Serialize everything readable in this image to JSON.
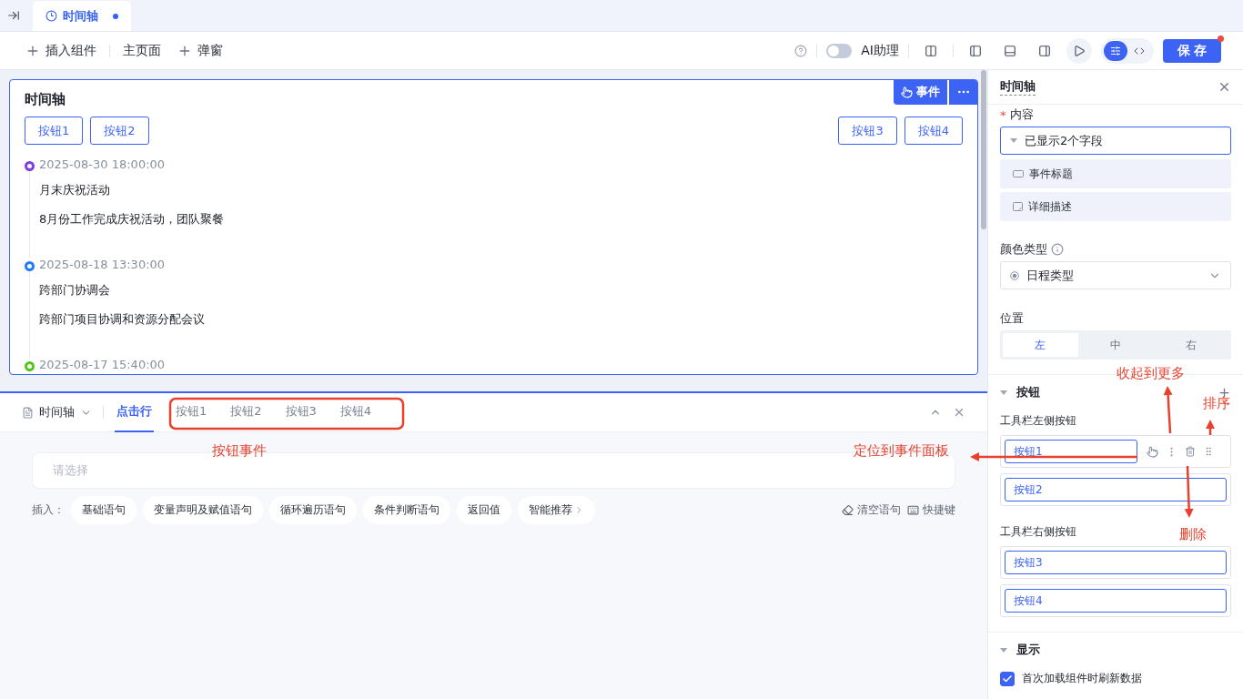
{
  "tab_bar": {
    "tabs": [
      {
        "label": "时间轴",
        "selected": true,
        "modified": true
      }
    ]
  },
  "toolbar": {
    "left": [
      {
        "label": "插入组件",
        "kind": "add"
      },
      {
        "label": "主页面",
        "kind": "page"
      },
      {
        "label": "弹窗",
        "kind": "add"
      }
    ],
    "ai_switch": {
      "label": "AI助理",
      "on": false
    },
    "view_toggle": [
      {
        "kind": "settings",
        "selected": true
      },
      {
        "kind": "code",
        "selected": false
      }
    ],
    "save": "保 存"
  },
  "canvas": {
    "card": {
      "title": "时间轴",
      "event_button": "事件",
      "left_buttons": [
        "按钮1",
        "按钮2"
      ],
      "right_buttons": [
        "按钮3",
        "按钮4"
      ],
      "items": [
        {
          "color": "#7b3fe4",
          "date": "2025-08-30 18:00:00",
          "title": "月末庆祝活动",
          "description": "8月份工作完成庆祝活动，团队聚餐"
        },
        {
          "color": "#1f7bff",
          "date": "2025-08-18 13:30:00",
          "title": "跨部门协调会",
          "description": "跨部门项目协调和资源分配会议"
        },
        {
          "color": "#52c41a",
          "date": "2025-08-17 15:40:00"
        }
      ]
    }
  },
  "event_panel": {
    "component": "时间轴",
    "tabs": [
      {
        "label": "点击行",
        "selected": true
      },
      {
        "label": "按钮1",
        "selected": false
      },
      {
        "label": "按钮2",
        "selected": false
      },
      {
        "label": "按钮3",
        "selected": false
      },
      {
        "label": "按钮4",
        "selected": false
      }
    ],
    "select_placeholder": "请选择",
    "insert_label": "插入：",
    "insert_chips": [
      {
        "label": "基础语句"
      },
      {
        "label": "变量声明及赋值语句"
      },
      {
        "label": "循环遍历语句"
      },
      {
        "label": "条件判断语句"
      },
      {
        "label": "返回值"
      },
      {
        "label": "智能推荐",
        "more": true
      }
    ],
    "clear": "清空语句",
    "shortcut": "快捷键"
  },
  "properties": {
    "title": "时间轴",
    "required_mark": "*",
    "content_label": "内容",
    "fields_summary": "已显示2个字段",
    "fields": [
      {
        "label": "事件标题",
        "kind": "single"
      },
      {
        "label": "详细描述",
        "kind": "multi"
      }
    ],
    "color_type_label": "颜色类型",
    "color_type_value": "日程类型",
    "position_label": "位置",
    "position": [
      {
        "label": "左",
        "selected": true
      },
      {
        "label": "中",
        "selected": false
      },
      {
        "label": "右",
        "selected": false
      }
    ],
    "buttons_section": "按钮",
    "left_label": "工具栏左侧按钮",
    "left_buttons": [
      {
        "label": "按钮1",
        "hovered": true
      },
      {
        "label": "按钮2",
        "hovered": false
      }
    ],
    "right_label": "工具栏右侧按钮",
    "right_buttons": [
      {
        "label": "按钮3",
        "hovered": false
      },
      {
        "label": "按钮4",
        "hovered": false
      }
    ],
    "display_section": "显示",
    "refresh": {
      "label": "首次加载组件时刷新数据",
      "checked": true
    }
  },
  "annotations": [
    {
      "text": "按钮事件"
    },
    {
      "text": "定位到事件面板"
    },
    {
      "text": "收起到更多"
    },
    {
      "text": "排序"
    },
    {
      "text": "删除"
    }
  ]
}
